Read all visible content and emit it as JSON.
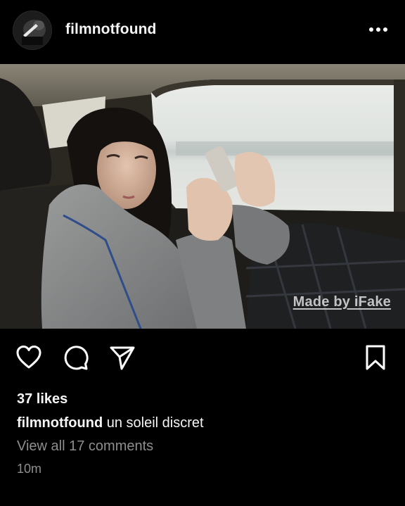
{
  "post": {
    "username": "filmnotfound",
    "more_icon": "more-horizontal-icon",
    "watermark": "Made by iFake",
    "likes": "37 likes",
    "caption_user": "filmnotfound",
    "caption_text": " un soleil discret",
    "view_comments": "View all 17 comments",
    "timestamp": "10m"
  },
  "icons": {
    "like": "heart-icon",
    "comment": "comment-icon",
    "share": "send-icon",
    "save": "bookmark-icon"
  },
  "colors": {
    "background": "#000000",
    "text_primary": "#f5f5f5",
    "text_secondary": "#8e8e8e"
  }
}
